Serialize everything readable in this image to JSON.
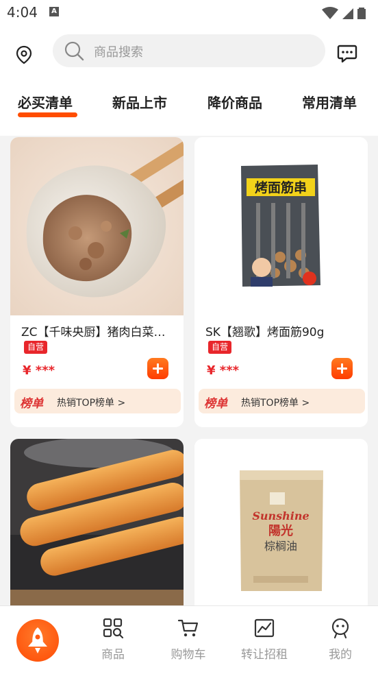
{
  "status_bar": {
    "time": "4:04",
    "notif_icon": "A"
  },
  "header": {
    "search_placeholder": "商品搜索",
    "tabs": [
      "必买清单",
      "新品上市",
      "降价商品",
      "常用清单"
    ],
    "active_tab_color": "#ff4d00"
  },
  "products": [
    {
      "title": "ZC【千味央厨】猪肉白菜…",
      "badge": "自营",
      "price": "¥ ***",
      "rank_logo": "榜单",
      "rank_text": "热销TOP榜单 >"
    },
    {
      "title": "SK【翘歌】烤面筋90g",
      "badge": "自营",
      "price": "¥ ***",
      "rank_logo": "榜单",
      "rank_text": "热销TOP榜单 >",
      "pack_text": "烤面筋串"
    },
    {
      "title": "",
      "image": "fried-dough-sticks"
    },
    {
      "title": "",
      "image": "palm-oil-box",
      "pack_brand": "Sunshine",
      "pack_cn": "陽光",
      "pack_label": "棕榈油"
    }
  ],
  "bottom_nav": {
    "items": [
      {
        "label": "商品",
        "icon": "grid-search-icon"
      },
      {
        "label": "购物车",
        "icon": "cart-icon"
      },
      {
        "label": "转让招租",
        "icon": "chart-icon"
      },
      {
        "label": "我的",
        "icon": "face-icon"
      }
    ]
  },
  "colors": {
    "brand": "#ff4d00",
    "price": "#e8262b"
  }
}
